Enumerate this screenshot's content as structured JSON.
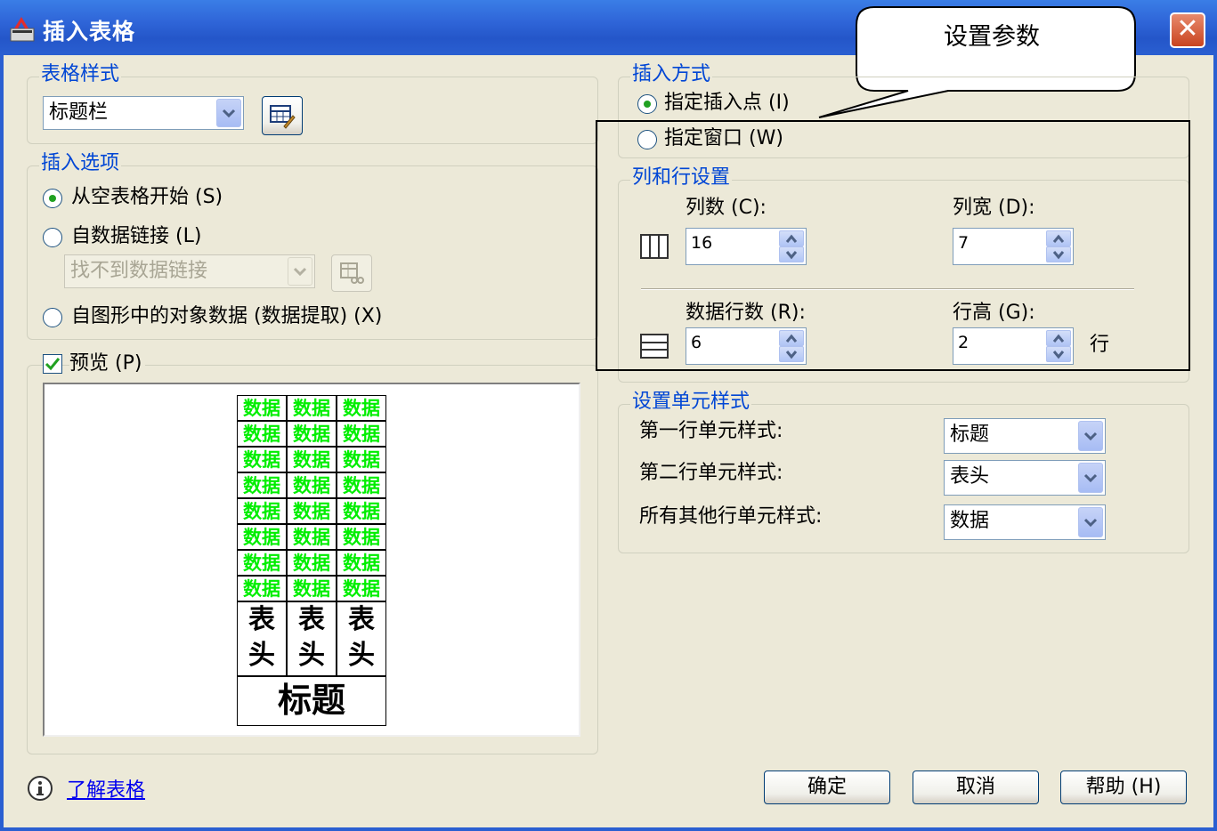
{
  "window": {
    "title": "插入表格",
    "close": "✕"
  },
  "callout": {
    "text": "设置参数"
  },
  "table_style": {
    "legend": "表格样式",
    "selected": "标题栏"
  },
  "insert_options": {
    "legend": "插入选项",
    "start_empty": "从空表格开始 (S)",
    "from_data_link": "自数据链接 (L)",
    "data_link_value": "找不到数据链接",
    "from_object_data": "自图形中的对象数据 (数据提取) (X)"
  },
  "preview": {
    "label": "预览 (P)",
    "checked": true,
    "data_cell": "数据",
    "header_top": "表",
    "header_bottom": "头",
    "title": "标题"
  },
  "insert_method": {
    "legend": "插入方式",
    "insert_point": "指定插入点 (I)",
    "insert_window": "指定窗口 (W)"
  },
  "col_row": {
    "legend": "列和行设置",
    "columns_label": "列数 (C):",
    "columns_value": "16",
    "col_width_label": "列宽 (D):",
    "col_width_value": "7",
    "rows_label": "数据行数 (R):",
    "rows_value": "6",
    "row_height_label": "行高 (G):",
    "row_height_value": "2",
    "row_unit": "行"
  },
  "cell_style": {
    "legend": "设置单元样式",
    "first_row_label": "第一行单元样式:",
    "first_row_value": "标题",
    "second_row_label": "第二行单元样式:",
    "second_row_value": "表头",
    "other_rows_label": "所有其他行单元样式:",
    "other_rows_value": "数据"
  },
  "footer": {
    "learn_link": "了解表格",
    "ok": "确定",
    "cancel": "取消",
    "help": "帮助 (H)"
  },
  "colors": {
    "titlebar": "#2a5fd1",
    "legend": "#0046d5",
    "preview_data": "#00ee00",
    "dialog_bg": "#ece9d8"
  }
}
